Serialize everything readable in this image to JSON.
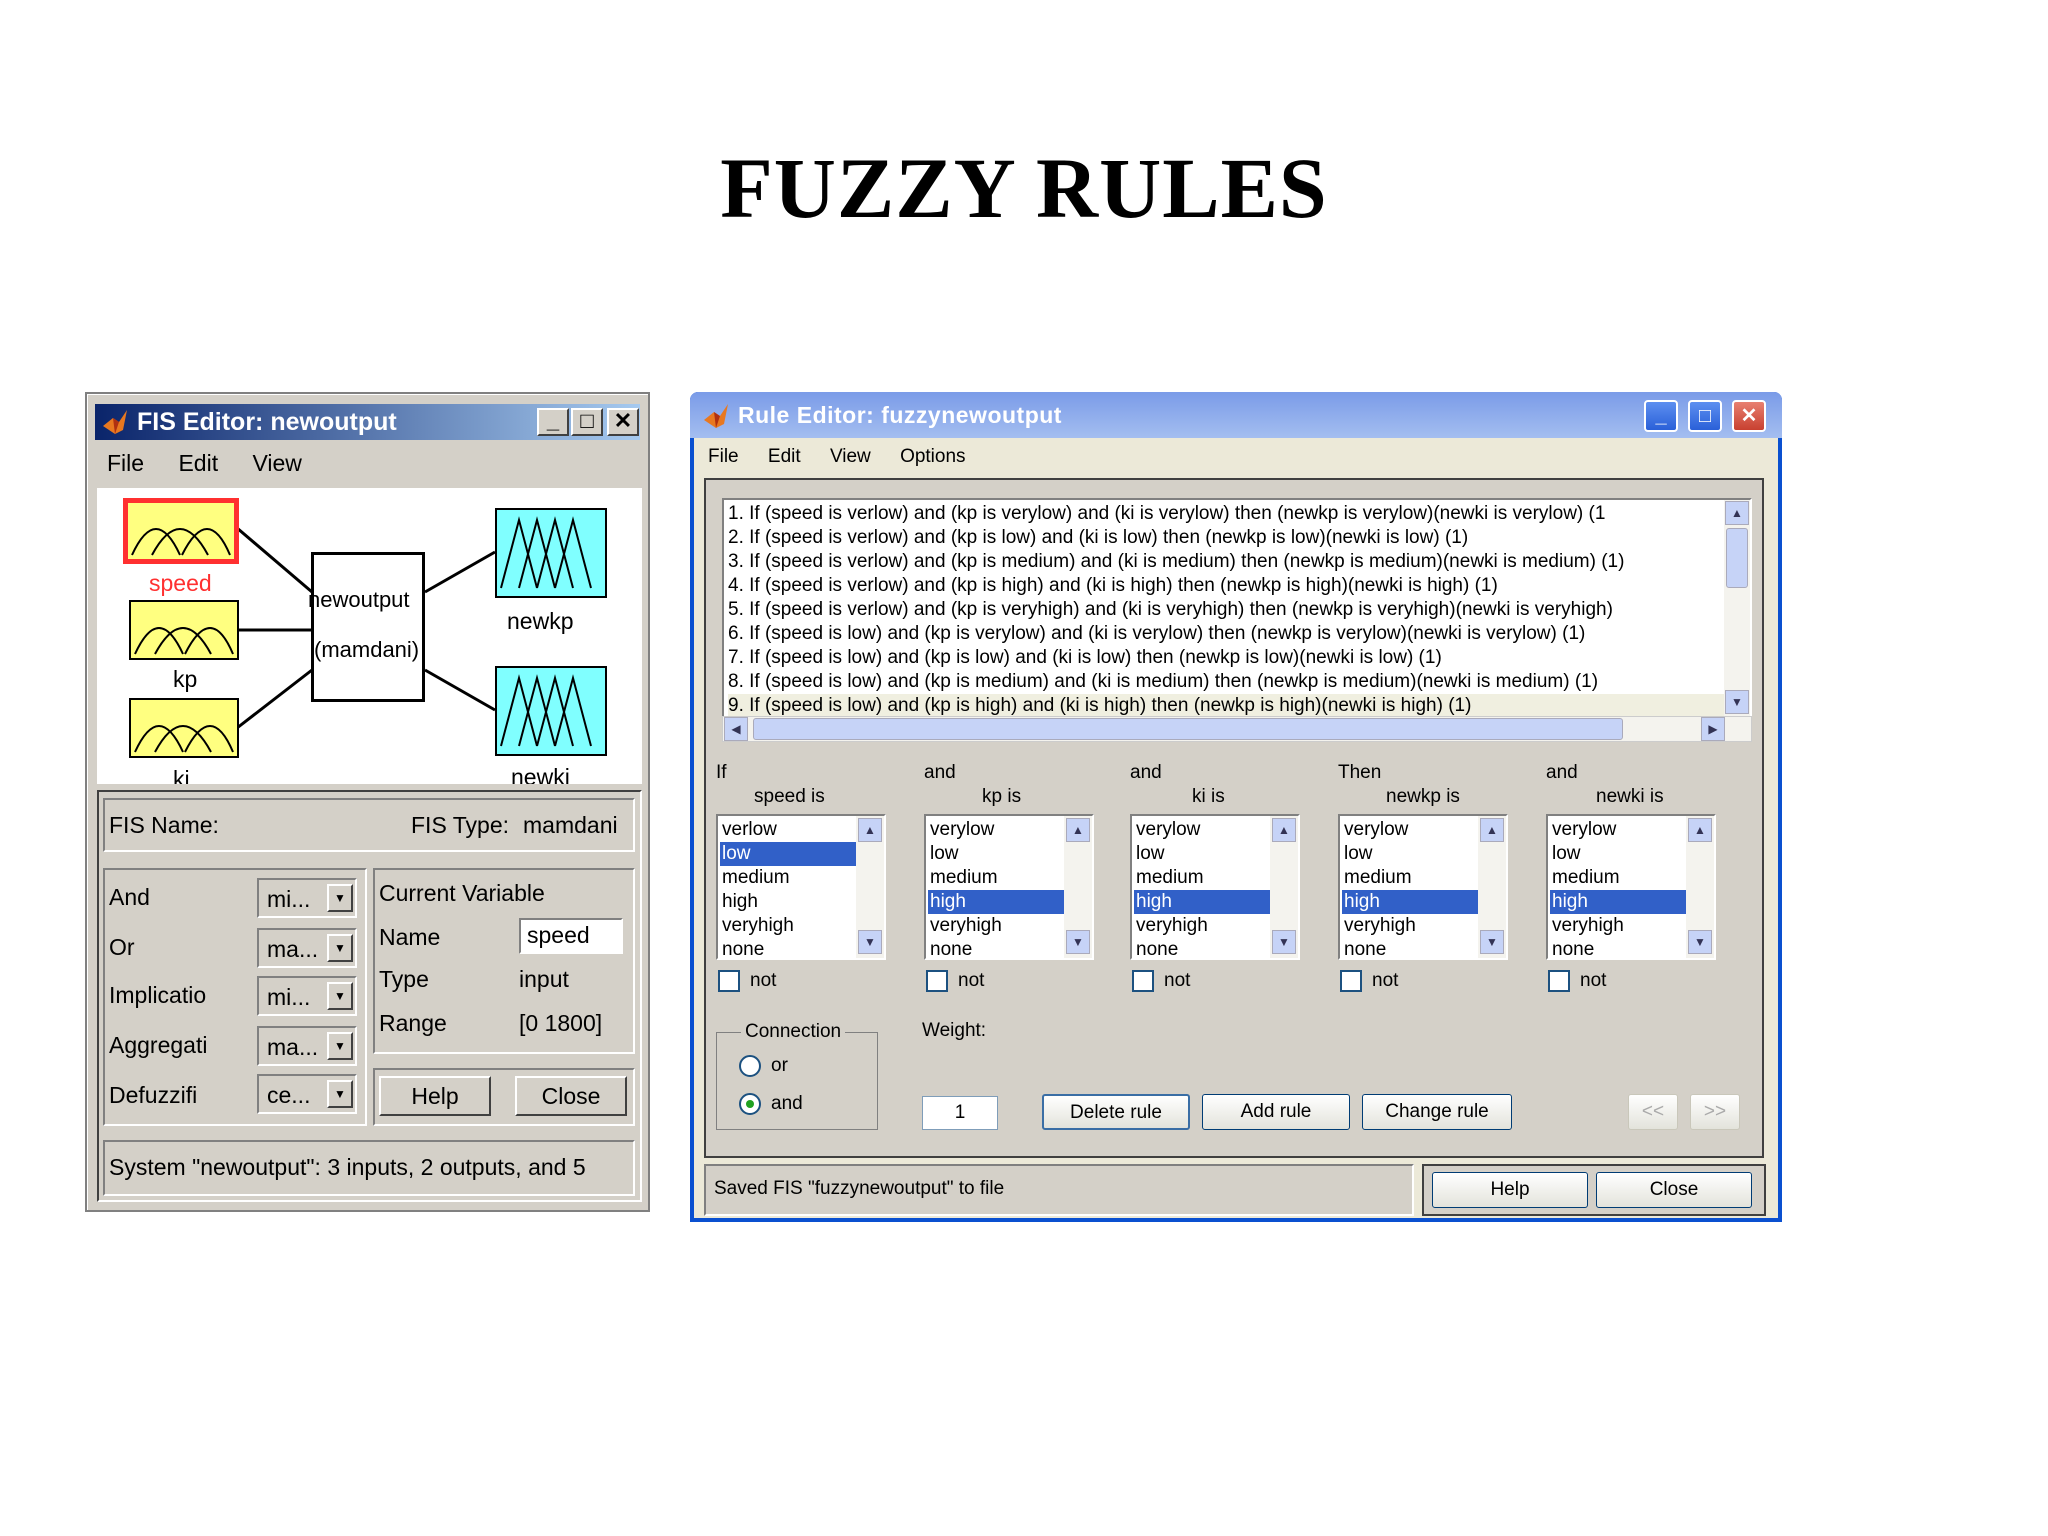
{
  "slide": {
    "title": "FUZZY RULES"
  },
  "fis_editor": {
    "title": "FIS Editor: newoutput",
    "menu": [
      "File",
      "Edit",
      "View"
    ],
    "diagram": {
      "inputs": [
        "speed",
        "kp",
        "ki"
      ],
      "outputs": [
        "newkp",
        "newki"
      ],
      "system_name": "newoutput",
      "system_type": "(mamdani)"
    },
    "fis_name_label": "FIS Name:",
    "fis_name_value": "",
    "fis_type_label": "FIS Type:",
    "fis_type_value": "mamdani",
    "methods": [
      {
        "label": "And",
        "value": "mi..."
      },
      {
        "label": "Or",
        "value": "ma..."
      },
      {
        "label": "Implicatio",
        "value": "mi..."
      },
      {
        "label": "Aggregati",
        "value": "ma..."
      },
      {
        "label": "Defuzzifi",
        "value": "ce..."
      }
    ],
    "current_variable": {
      "heading": "Current Variable",
      "name_label": "Name",
      "name_value": "speed",
      "type_label": "Type",
      "type_value": "input",
      "range_label": "Range",
      "range_value": "[0 1800]"
    },
    "help_label": "Help",
    "close_label": "Close",
    "status": "System \"newoutput\": 3 inputs, 2 outputs, and 5"
  },
  "rule_editor": {
    "title": "Rule Editor: fuzzynewoutput",
    "menu": [
      "File",
      "Edit",
      "View",
      "Options"
    ],
    "rules": [
      "1. If (speed is verlow) and (kp is verylow) and (ki is verylow) then (newkp is verylow)(newki is verylow) (1",
      "2. If (speed is verlow) and (kp is low) and (ki is low) then (newkp is low)(newki is low) (1)",
      "3. If (speed is verlow) and (kp is medium) and (ki is medium) then (newkp is medium)(newki is medium) (1)",
      "4. If (speed is verlow) and (kp is high) and (ki is high) then (newkp is high)(newki is high) (1)",
      "5. If (speed is verlow) and (kp is veryhigh) and (ki is veryhigh) then (newkp is veryhigh)(newki is veryhigh)",
      "6. If (speed is low) and (kp is verylow) and (ki is verylow) then (newkp is verylow)(newki is verylow) (1)",
      "7. If (speed is low) and (kp is low) and (ki is low) then (newkp is low)(newki is low) (1)",
      "8. If (speed is low) and (kp is medium) and (ki is medium) then (newkp is medium)(newki is medium) (1)",
      "9. If (speed is low) and (kp is high) and (ki is high) then (newkp is high)(newki is high) (1)"
    ],
    "columns": [
      {
        "prefix": "If",
        "heading": "speed is",
        "items": [
          "verlow",
          "low",
          "medium",
          "high",
          "veryhigh",
          "none"
        ],
        "selected": 1
      },
      {
        "prefix": "and",
        "heading": "kp is",
        "items": [
          "verylow",
          "low",
          "medium",
          "high",
          "veryhigh",
          "none"
        ],
        "selected": 3
      },
      {
        "prefix": "and",
        "heading": "ki is",
        "items": [
          "verylow",
          "low",
          "medium",
          "high",
          "veryhigh",
          "none"
        ],
        "selected": 3
      },
      {
        "prefix": "Then",
        "heading": "newkp is",
        "items": [
          "verylow",
          "low",
          "medium",
          "high",
          "veryhigh",
          "none"
        ],
        "selected": 3
      },
      {
        "prefix": "and",
        "heading": "newki is",
        "items": [
          "verylow",
          "low",
          "medium",
          "high",
          "veryhigh",
          "none"
        ],
        "selected": 3
      }
    ],
    "not_label": "not",
    "connection": {
      "label": "Connection",
      "or_label": "or",
      "and_label": "and",
      "selected": "and"
    },
    "weight_label": "Weight:",
    "weight_value": "1",
    "delete_rule_label": "Delete rule",
    "add_rule_label": "Add rule",
    "change_rule_label": "Change rule",
    "prev_label": "<<",
    "next_label": ">>",
    "status": "Saved FIS \"fuzzynewoutput\" to file",
    "help_label": "Help",
    "close_label": "Close"
  }
}
